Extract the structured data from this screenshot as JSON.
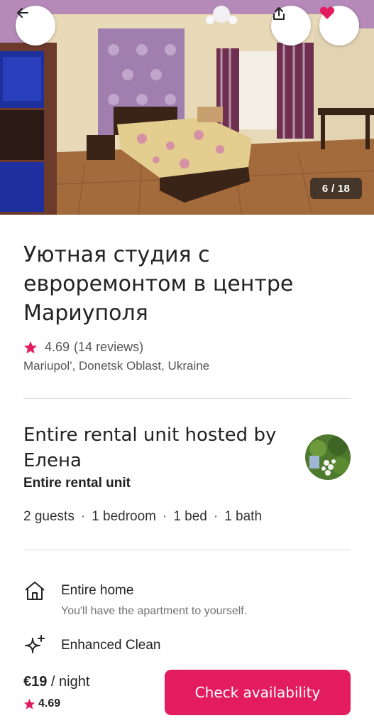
{
  "hero": {
    "photo_counter": "6 / 18",
    "back_icon": "arrow-left-icon",
    "share_icon": "share-icon",
    "favorite_icon": "heart-icon",
    "favorite_color": "#e31c5f"
  },
  "listing": {
    "title": "Уютная студия с евроремонтом в центре Мариуполя",
    "rating": "4.69",
    "reviews": "(14 reviews)",
    "location": "Mariupol', Donetsk Oblast, Ukraine"
  },
  "host": {
    "title": "Entire rental unit hosted by Елена",
    "subtitle": "Entire rental unit",
    "specs": [
      "2 guests",
      "1 bedroom",
      "1 bed",
      "1 bath"
    ],
    "spec_separator": "·"
  },
  "features": [
    {
      "icon": "home-icon",
      "title": "Entire home",
      "description": "You'll have the apartment to yourself."
    },
    {
      "icon": "sparkle-icon",
      "title": "Enhanced Clean",
      "description": ""
    }
  ],
  "footer": {
    "price": "€19",
    "per_night": " / night",
    "rating": "4.69",
    "cta_label": "Check availability"
  },
  "colors": {
    "brand": "#e31c5f",
    "text_primary": "#222222",
    "text_secondary": "#717171"
  }
}
